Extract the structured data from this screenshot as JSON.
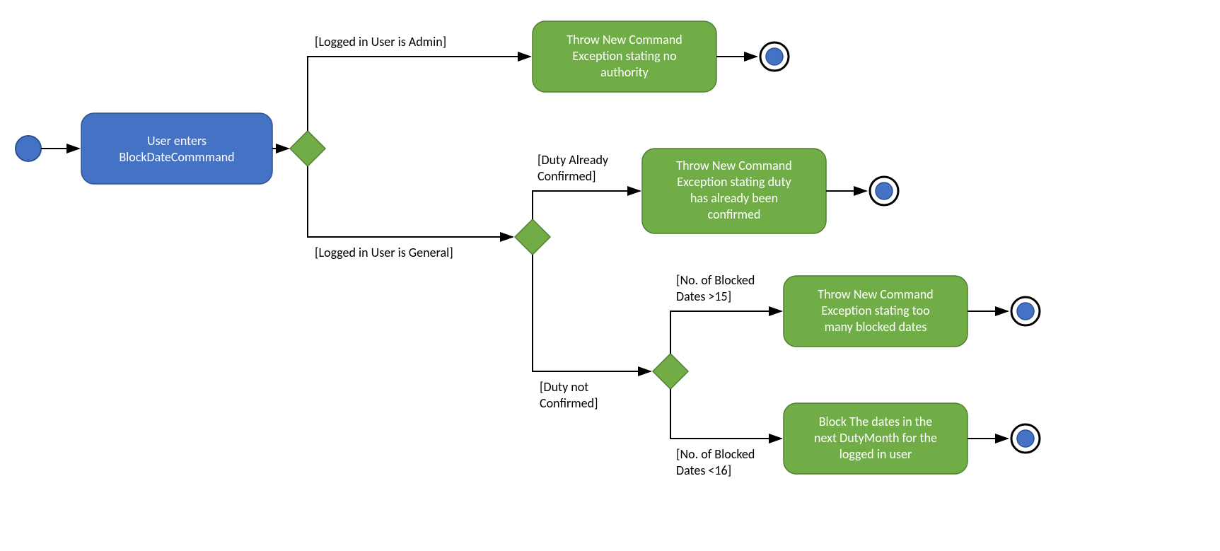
{
  "nodes": {
    "start_box": {
      "line1": "User enters",
      "line2": "BlockDateCommmand"
    },
    "admin_box": {
      "line1": "Throw New Command",
      "line2": "Exception stating no",
      "line3": "authority"
    },
    "duty_confirmed_box": {
      "line1": "Throw New Command",
      "line2": "Exception stating duty",
      "line3": "has already been",
      "line4": "confirmed"
    },
    "too_many_box": {
      "line1": "Throw New Command",
      "line2": "Exception stating too",
      "line3": "many blocked dates"
    },
    "block_box": {
      "line1": "Block The dates in the",
      "line2": "next DutyMonth for the",
      "line3": "logged in user"
    }
  },
  "labels": {
    "admin": "[Logged in User is Admin]",
    "general": "[Logged in User is General]",
    "duty_confirmed1": "[Duty Already",
    "duty_confirmed2": "Confirmed]",
    "duty_not1": "[Duty not",
    "duty_not2": "Confirmed]",
    "gt15_1": "[No. of Blocked",
    "gt15_2": "Dates >15]",
    "lt16_1": "[No. of Blocked",
    "lt16_2": "Dates <16]"
  }
}
